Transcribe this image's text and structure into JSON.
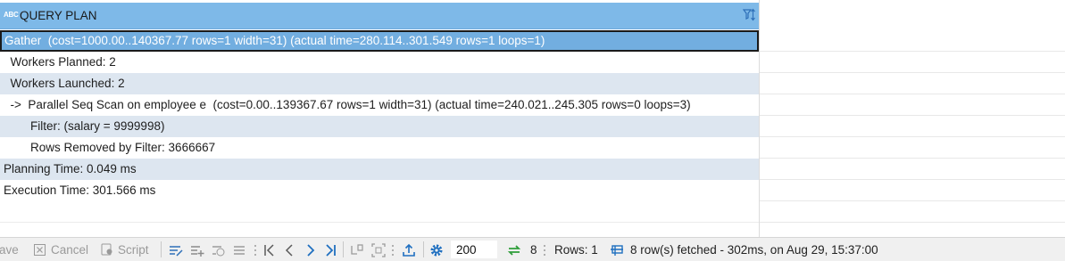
{
  "grid": {
    "column": {
      "type_badge": "ABC",
      "title": "QUERY PLAN"
    },
    "rows": [
      {
        "text": "Gather  (cost=1000.00..140367.77 rows=1 width=31) (actual time=280.114..301.549 rows=1 loops=1)"
      },
      {
        "text": "  Workers Planned: 2"
      },
      {
        "text": "  Workers Launched: 2"
      },
      {
        "text": "  ->  Parallel Seq Scan on employee e  (cost=0.00..139367.67 rows=1 width=31) (actual time=240.021..245.305 rows=0 loops=3)"
      },
      {
        "text": "        Filter: (salary = 9999998)"
      },
      {
        "text": "        Rows Removed by Filter: 3666667"
      },
      {
        "text": "Planning Time: 0.049 ms"
      },
      {
        "text": "Execution Time: 301.566 ms"
      }
    ]
  },
  "toolbar": {
    "save_label": "Save",
    "cancel_label": "Cancel",
    "script_label": "Script",
    "fetch_size": "200",
    "refresh_count": "8",
    "rows_label": "Rows: 1",
    "status_text": "8 row(s) fetched - 302ms, on Aug 29, 15:37:00"
  },
  "colors": {
    "header_bg": "#7eb9e8",
    "selected_row_bg": "#72aee0",
    "alt_row_bg": "#dde6f0",
    "accent_blue": "#1f6fc0",
    "refresh_green": "#2e9d3a"
  },
  "icons": [
    "text-type-icon",
    "filter-sort-icon",
    "cancel-icon",
    "script-icon",
    "edit-row-icon",
    "add-row-icon",
    "copy-row-icon",
    "delete-row-icon",
    "first-page-icon",
    "prev-page-icon",
    "next-page-icon",
    "last-page-icon",
    "fetch-next-icon",
    "fetch-all-icon",
    "export-icon",
    "settings-icon",
    "refresh-icon",
    "panel-icon"
  ]
}
